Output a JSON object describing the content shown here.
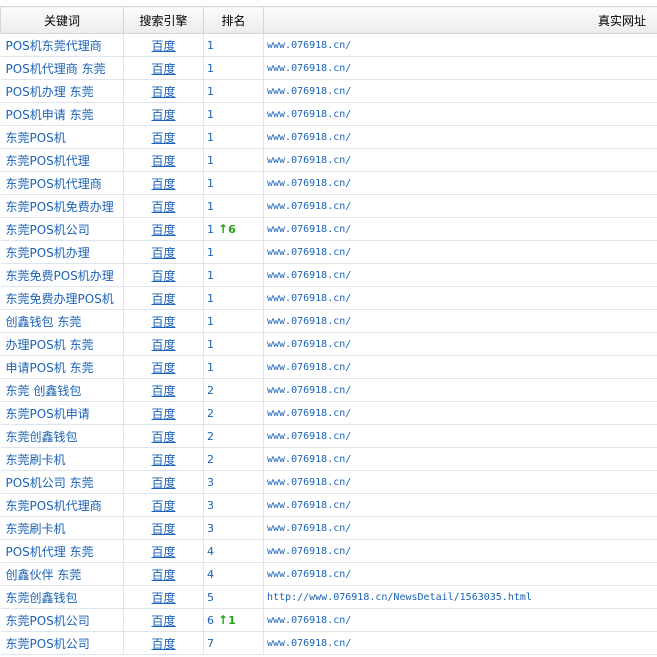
{
  "headers": {
    "keyword": "关键词",
    "engine": "搜索引擎",
    "rank": "排名",
    "url": "真实网址"
  },
  "rows": [
    {
      "keyword": "POS机东莞代理商",
      "engine": "百度",
      "rank": "1",
      "change": "",
      "url": "www.076918.cn/"
    },
    {
      "keyword": "POS机代理商 东莞",
      "engine": "百度",
      "rank": "1",
      "change": "",
      "url": "www.076918.cn/"
    },
    {
      "keyword": "POS机办理 东莞",
      "engine": "百度",
      "rank": "1",
      "change": "",
      "url": "www.076918.cn/"
    },
    {
      "keyword": "POS机申请 东莞",
      "engine": "百度",
      "rank": "1",
      "change": "",
      "url": "www.076918.cn/"
    },
    {
      "keyword": "东莞POS机",
      "engine": "百度",
      "rank": "1",
      "change": "",
      "url": "www.076918.cn/"
    },
    {
      "keyword": "东莞POS机代理",
      "engine": "百度",
      "rank": "1",
      "change": "",
      "url": "www.076918.cn/"
    },
    {
      "keyword": "东莞POS机代理商",
      "engine": "百度",
      "rank": "1",
      "change": "",
      "url": "www.076918.cn/"
    },
    {
      "keyword": "东莞POS机免费办理",
      "engine": "百度",
      "rank": "1",
      "change": "",
      "url": "www.076918.cn/"
    },
    {
      "keyword": "东莞POS机公司",
      "engine": "百度",
      "rank": "1",
      "change": "6",
      "url": "www.076918.cn/"
    },
    {
      "keyword": "东莞POS机办理",
      "engine": "百度",
      "rank": "1",
      "change": "",
      "url": "www.076918.cn/"
    },
    {
      "keyword": "东莞免费POS机办理",
      "engine": "百度",
      "rank": "1",
      "change": "",
      "url": "www.076918.cn/"
    },
    {
      "keyword": "东莞免费办理POS机",
      "engine": "百度",
      "rank": "1",
      "change": "",
      "url": "www.076918.cn/"
    },
    {
      "keyword": "创鑫钱包 东莞",
      "engine": "百度",
      "rank": "1",
      "change": "",
      "url": "www.076918.cn/"
    },
    {
      "keyword": "办理POS机 东莞",
      "engine": "百度",
      "rank": "1",
      "change": "",
      "url": "www.076918.cn/"
    },
    {
      "keyword": "申请POS机 东莞",
      "engine": "百度",
      "rank": "1",
      "change": "",
      "url": "www.076918.cn/"
    },
    {
      "keyword": "东莞 创鑫钱包",
      "engine": "百度",
      "rank": "2",
      "change": "",
      "url": "www.076918.cn/"
    },
    {
      "keyword": "东莞POS机申请",
      "engine": "百度",
      "rank": "2",
      "change": "",
      "url": "www.076918.cn/"
    },
    {
      "keyword": "东莞创鑫钱包",
      "engine": "百度",
      "rank": "2",
      "change": "",
      "url": "www.076918.cn/"
    },
    {
      "keyword": "东莞刷卡机",
      "engine": "百度",
      "rank": "2",
      "change": "",
      "url": "www.076918.cn/"
    },
    {
      "keyword": "POS机公司 东莞",
      "engine": "百度",
      "rank": "3",
      "change": "",
      "url": "www.076918.cn/"
    },
    {
      "keyword": "东莞POS机代理商",
      "engine": "百度",
      "rank": "3",
      "change": "",
      "url": "www.076918.cn/"
    },
    {
      "keyword": "东莞刷卡机",
      "engine": "百度",
      "rank": "3",
      "change": "",
      "url": "www.076918.cn/"
    },
    {
      "keyword": "POS机代理 东莞",
      "engine": "百度",
      "rank": "4",
      "change": "",
      "url": "www.076918.cn/"
    },
    {
      "keyword": "创鑫伙伴 东莞",
      "engine": "百度",
      "rank": "4",
      "change": "",
      "url": "www.076918.cn/"
    },
    {
      "keyword": "东莞创鑫钱包",
      "engine": "百度",
      "rank": "5",
      "change": "",
      "url": "http://www.076918.cn/NewsDetail/1563035.html"
    },
    {
      "keyword": "东莞POS机公司",
      "engine": "百度",
      "rank": "6",
      "change": "1",
      "url": "www.076918.cn/"
    },
    {
      "keyword": "东莞POS机公司",
      "engine": "百度",
      "rank": "7",
      "change": "",
      "url": "www.076918.cn/"
    }
  ],
  "colors": {
    "link": "#1a62b8",
    "up": "#27a01a"
  },
  "icons": {
    "rank_up": "up-arrow-icon"
  }
}
